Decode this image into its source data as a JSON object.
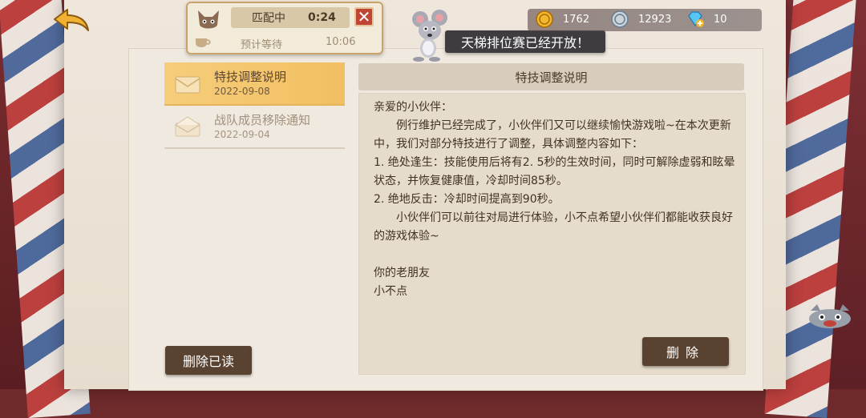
{
  "match": {
    "status_label": "匹配中",
    "elapsed": "0:24",
    "close_icon": "close-icon",
    "wait_label": "预计等待",
    "wait_time": "10:06"
  },
  "banner": {
    "text": "天梯排位赛已经开放！"
  },
  "currency": {
    "gold": "1762",
    "silver": "12923",
    "gems": "10"
  },
  "mail_list": [
    {
      "title": "特技调整说明",
      "date": "2022-09-08",
      "active": true
    },
    {
      "title": "战队成员移除通知",
      "date": "2022-09-04",
      "active": false
    }
  ],
  "content": {
    "header": "特技调整说明",
    "greeting": "亲爱的小伙伴：",
    "para1": "例行维护已经完成了，小伙伴们又可以继续愉快游戏啦~在本次更新中，我们对部分特技进行了调整，具体调整内容如下：",
    "item1": "1. 绝处逢生：技能使用后将有2. 5秒的生效时间，同时可解除虚弱和眩晕状态，并恢复健康值，冷却时间85秒。",
    "item2": "2. 绝地反击：冷却时间提高到90秒。",
    "para2": "小伙伴们可以前往对局进行体验，小不点希望小伙伴们都能收获良好的游戏体验~",
    "sign1": "你的老朋友",
    "sign2": "小不点"
  },
  "buttons": {
    "delete_read": "删除已读",
    "delete": "删除"
  },
  "colors": {
    "accent_gold": "#f2bf62",
    "button_brown": "#5a4230",
    "close_red": "#bf4535"
  }
}
